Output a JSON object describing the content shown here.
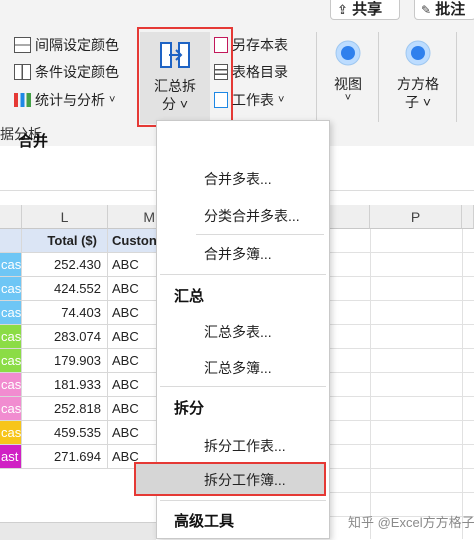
{
  "top": {
    "share_label": "共享",
    "comment_label": "批注"
  },
  "ribbon": {
    "left_items": [
      {
        "label": "间隔设定颜色",
        "icon": "grid-icon"
      },
      {
        "label": "条件设定颜色",
        "icon": "grid-icon"
      },
      {
        "label": "统计与分析",
        "icon": "chart-icon",
        "dropdown": "˅"
      }
    ],
    "group_label": "据分析",
    "summary_split": {
      "line1": "汇总拆",
      "line2": "分 ˅"
    },
    "right_items": [
      {
        "label": "另存本表",
        "icon": "save-icon"
      },
      {
        "label": "表格目录",
        "icon": "table-icon"
      },
      {
        "label": "工作表",
        "icon": "sheet-icon",
        "dropdown": "˅"
      }
    ],
    "view": {
      "label": "视图",
      "dropdown": "˅"
    },
    "fangfang": {
      "line1": "方方格",
      "line2": "子 ˅"
    }
  },
  "sheet": {
    "columns": [
      "L",
      "M",
      "P"
    ],
    "header_row": {
      "total": "Total ($)",
      "customer": "Custon"
    },
    "rows": [
      {
        "a": "cast",
        "total": "252.430",
        "customer": "ABC",
        "color": "#6ec6f5"
      },
      {
        "a": "cast",
        "total": "424.552",
        "customer": "ABC",
        "color": "#6ec6f5"
      },
      {
        "a": "cast",
        "total": "74.403",
        "customer": "ABC",
        "color": "#6ec6f5"
      },
      {
        "a": "cast",
        "total": "283.074",
        "customer": "ABC",
        "color": "#8bdc46"
      },
      {
        "a": "cast",
        "total": "179.903",
        "customer": "ABC",
        "color": "#8bdc46"
      },
      {
        "a": "cast",
        "total": "181.933",
        "customer": "ABC",
        "color": "#f18cd0"
      },
      {
        "a": "cast",
        "total": "252.818",
        "customer": "ABC",
        "color": "#f18cd0"
      },
      {
        "a": "cast",
        "total": "459.535",
        "customer": "ABC",
        "color": "#f7c51a"
      },
      {
        "a": "ast",
        "total": "271.694",
        "customer": "ABC",
        "color": "#d020c4"
      }
    ]
  },
  "menu": {
    "sections": [
      {
        "header": "合并",
        "items": [
          "合并多表...",
          "分类合并多表...",
          "合并多簿..."
        ]
      },
      {
        "header": "汇总",
        "items": [
          "汇总多表...",
          "汇总多簿..."
        ]
      },
      {
        "header": "拆分",
        "items": [
          "拆分工作表...",
          "拆分工作簿..."
        ]
      },
      {
        "header": "高级工具",
        "items": []
      }
    ]
  },
  "watermark": "知乎 @Excel方方格子",
  "colors": {
    "highlight": "#e53935",
    "selected_item": "#d6d6d6",
    "header_fill": "#dbe5f5"
  }
}
